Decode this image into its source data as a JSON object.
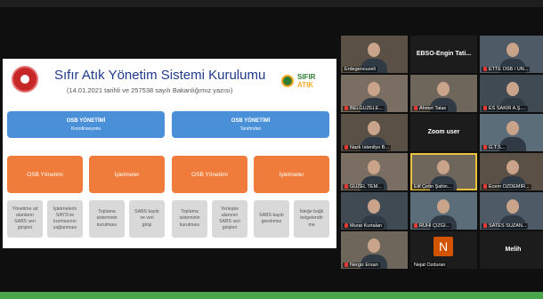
{
  "slide": {
    "title": "Sıfır Atık Yönetim Sistemi Kurulumu",
    "subtitle": "(14.01.2021 tarihli ve 257538 sayılı Bakanlığımız yazısı)",
    "logo_line1": "SIFIR",
    "logo_line2": "ATIK",
    "blue_left_l1": "OSB YÖNETİMİ",
    "blue_left_l2": "Koordinasyonu",
    "blue_right_l1": "OSB YÖNETİMİ",
    "blue_right_l2": "Tarafından",
    "orange": [
      "OSB Yönetimi",
      "İşletmeler",
      "OSB Yönetimi",
      "İşletmeler"
    ],
    "grey": [
      "Yönetime ait\nalanların\nSABS veri\ngirişleri",
      "İşletmelerin\nSAYS'ne\nkurmasının\nsağlanması",
      "Toplama\nsisteminin\nkurulması",
      "SABS kaydı\nve veri\ngirişi",
      "Toplama\nsisteminin\nkurulması",
      "Yerleşke\nalanının\nSABS veri\ngirişleri",
      "SABS kaydı\ngerekmez",
      "İsteğe bağlı\nbelgelendir\nme"
    ]
  },
  "participants": [
    {
      "name": "Erdegencuzeli",
      "muted": false,
      "tone": "p1"
    },
    {
      "name": "EBSO-Engin Tati...",
      "muted": false,
      "tone": "dark",
      "center": true
    },
    {
      "name": "ETTE OSB / ÜN...",
      "muted": true,
      "tone": "p3"
    },
    {
      "name": "BELGÜZELE...",
      "muted": true,
      "tone": "p4"
    },
    {
      "name": "Ahmet Talas",
      "muted": true,
      "tone": "p2"
    },
    {
      "name": "ES SAKIR A.Ş....",
      "muted": true,
      "tone": "p5"
    },
    {
      "name": "Nazlı İstenilyo B...",
      "muted": true,
      "tone": "p1"
    },
    {
      "name": "Zoom user",
      "muted": false,
      "tone": "dark",
      "center": true
    },
    {
      "name": "G.T.S...",
      "muted": true,
      "tone": "p6"
    },
    {
      "name": "GÜZEL TEM...",
      "muted": true,
      "tone": "p4"
    },
    {
      "name": "Elif Çetin Şahin...",
      "muted": false,
      "tone": "p2",
      "selected": true
    },
    {
      "name": "Ecem ÖZDEMİR...",
      "muted": true,
      "tone": "p1"
    },
    {
      "name": "Murat Kurtalan",
      "muted": true,
      "tone": "p5"
    },
    {
      "name": "RUHİ ÇİZGİ...",
      "muted": true,
      "tone": "p6"
    },
    {
      "name": "SATES SUZAN...",
      "muted": true,
      "tone": "p3"
    },
    {
      "name": "Nergiz Ersan",
      "muted": true,
      "tone": "p2"
    },
    {
      "name": "Nejat Özduran",
      "muted": false,
      "tone": "dark",
      "avatar": "N"
    },
    {
      "name": "Melih",
      "muted": false,
      "tone": "dark",
      "center": true
    }
  ]
}
